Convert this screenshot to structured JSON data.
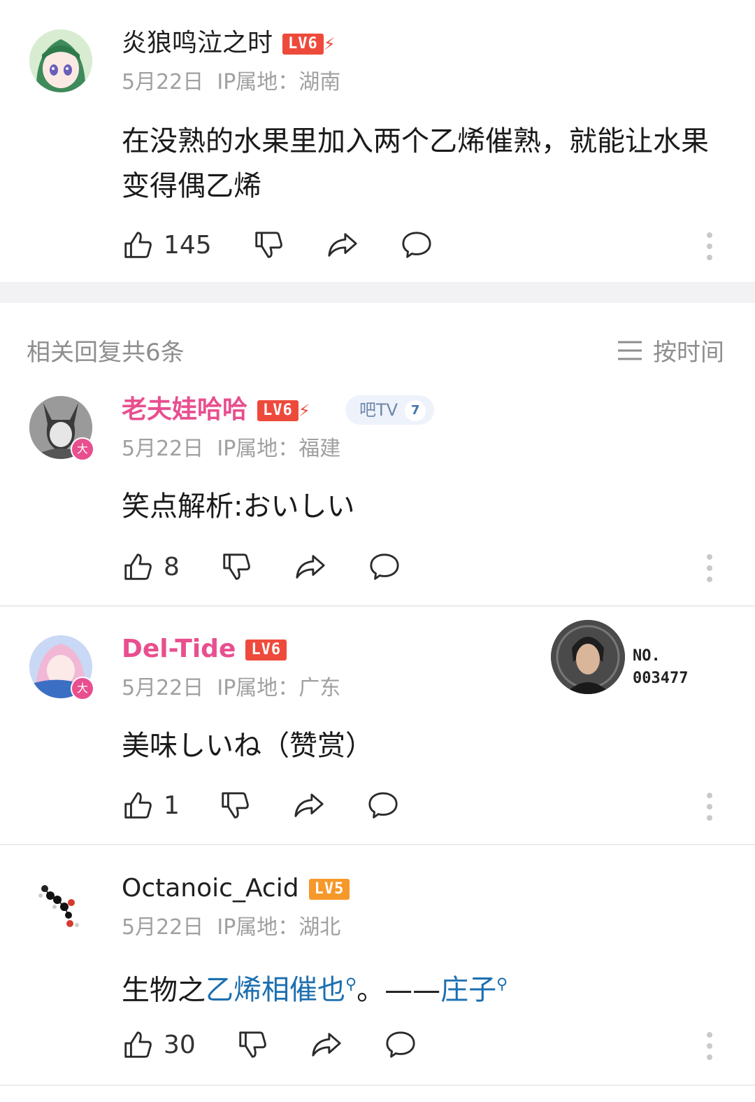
{
  "top_comment": {
    "username": "炎狼鸣泣之时",
    "level": "LV6",
    "date": "5月22日",
    "ip": "IP属地：湖南",
    "content": "在没熟的水果里加入两个乙烯催熟，就能让水果变得偶乙烯",
    "likes": "145"
  },
  "replies_header": {
    "title": "相关回复共6条",
    "sort_label": "按时间"
  },
  "replies": [
    {
      "username": "老夫娃哈哈",
      "level": "LV6",
      "badge_label": "吧TV",
      "badge_number": "7",
      "date": "5月22日",
      "ip": "IP属地：福建",
      "content": "笑点解析:おいしい",
      "likes": "8"
    },
    {
      "username": "Del-Tide",
      "level": "LV6",
      "date": "5月22日",
      "ip": "IP属地：广东",
      "content": "美味しいね（赞赏）",
      "likes": "1",
      "card_no_label": "NO.",
      "card_no_value": "003477"
    },
    {
      "username": "Octanoic_Acid",
      "level": "LV5",
      "date": "5月22日",
      "ip": "IP属地：湖北",
      "content_prefix": "生物之",
      "content_link1": "乙烯相催也",
      "content_mid": "。——",
      "content_link2": "庄子",
      "likes": "30"
    }
  ],
  "colors": {
    "accent_pink": "#e84f8f",
    "level_red": "#ee4a3c",
    "level_orange": "#f7982a",
    "link_blue": "#1c6fb0",
    "meta_gray": "#a0a0a0"
  },
  "icons": [
    "thumb-up-icon",
    "thumb-down-icon",
    "share-icon",
    "comment-icon",
    "more-vertical-icon",
    "sort-lines-icon",
    "search-icon"
  ]
}
